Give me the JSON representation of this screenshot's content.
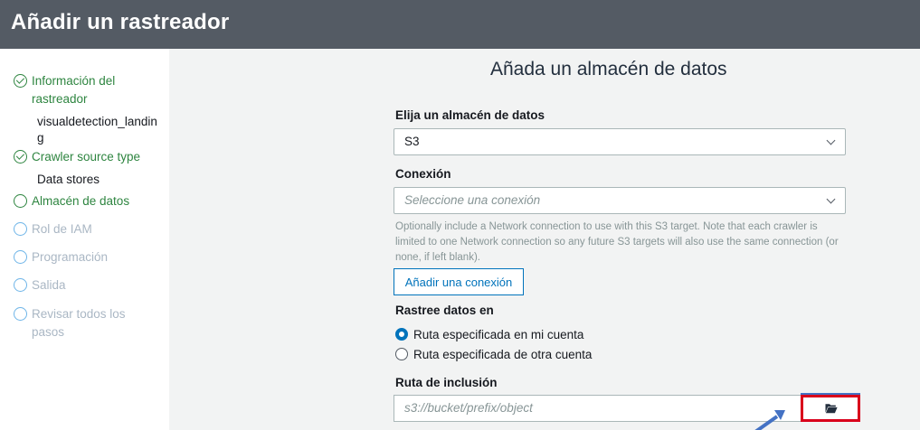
{
  "header": {
    "title": "Añadir un rastreador"
  },
  "sidebar": {
    "steps": [
      {
        "label": "Información del rastreador",
        "state": "done",
        "detail": "visualdetection_landing"
      },
      {
        "label": "Crawler source type",
        "state": "done",
        "detail": "Data stores"
      },
      {
        "label": "Almacén de datos",
        "state": "current"
      },
      {
        "label": "Rol de IAM",
        "state": "todo"
      },
      {
        "label": "Programación",
        "state": "todo"
      },
      {
        "label": "Salida",
        "state": "todo"
      },
      {
        "label": "Revisar todos los pasos",
        "state": "todo"
      }
    ]
  },
  "main": {
    "title": "Añada un almacén de datos",
    "datastore": {
      "label": "Elija un almacén de datos",
      "value": "S3"
    },
    "connection": {
      "label": "Conexión",
      "placeholder": "Seleccione una conexión",
      "help": "Optionally include a Network connection to use with this S3 target. Note that each crawler is limited to one Network connection so any future S3 targets will also use the same connection (or none, if left blank).",
      "add_button": "Añadir una conexión"
    },
    "crawl": {
      "label": "Rastree datos en",
      "options": [
        {
          "label": "Ruta especificada en mi cuenta",
          "checked": true
        },
        {
          "label": "Ruta especificada de otra cuenta",
          "checked": false
        }
      ]
    },
    "include_path": {
      "label": "Ruta de inclusión",
      "placeholder": "s3://bucket/prefix/object"
    }
  },
  "colors": {
    "header_bg": "#545b64",
    "success": "#2e8540",
    "link": "#0073bb",
    "highlight_box": "#d9001b",
    "arrow": "#4472c4"
  },
  "icons": [
    "check-circle-icon",
    "chevron-down-icon",
    "folder-open-icon",
    "annotation-arrow-icon"
  ]
}
